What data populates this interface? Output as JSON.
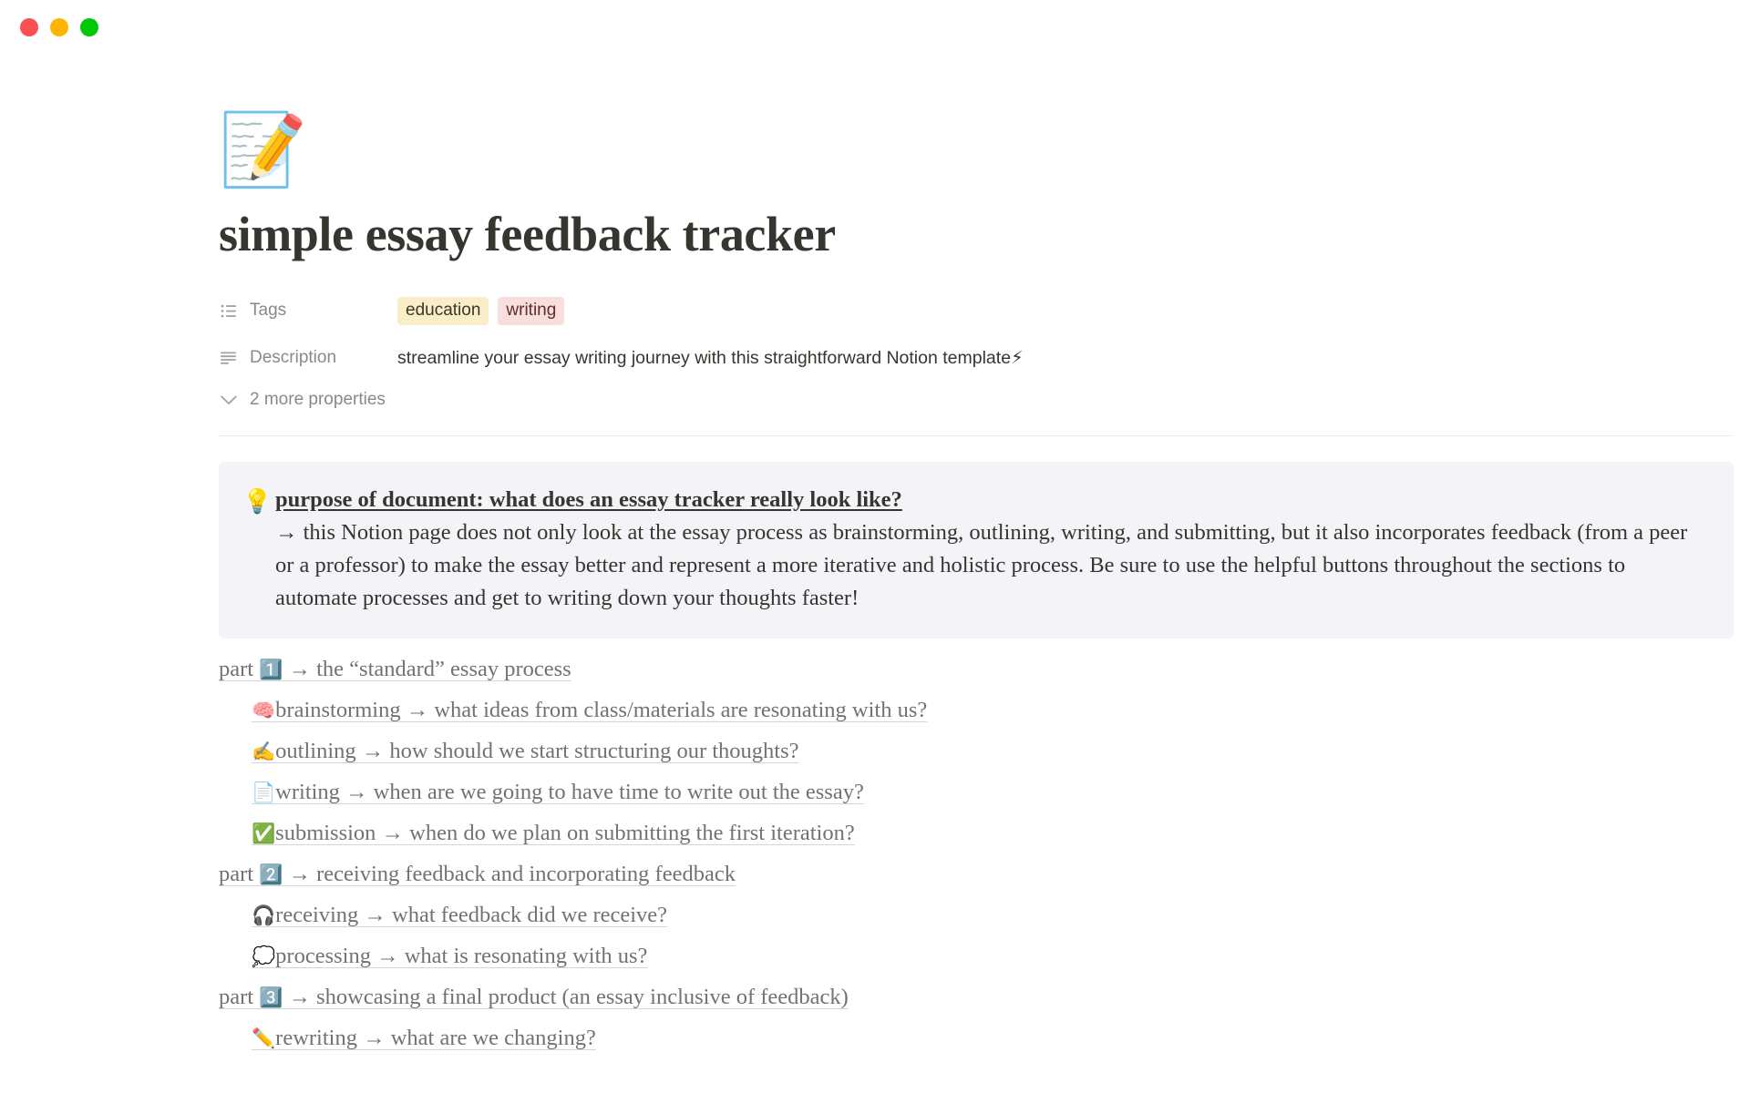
{
  "window": {
    "controls": [
      {
        "name": "close",
        "color": "#fc4f53"
      },
      {
        "name": "minimize",
        "color": "#ffb402"
      },
      {
        "name": "maximize",
        "color": "#00c707"
      }
    ]
  },
  "page": {
    "icon": "📝",
    "title": "simple essay feedback tracker"
  },
  "properties": {
    "rows": [
      {
        "icon": "multi-select-icon",
        "label": "Tags",
        "type": "tags",
        "tags": [
          {
            "label": "education",
            "bg": "#faeec8",
            "fg": "#3c3528"
          },
          {
            "label": "writing",
            "bg": "#f8dfde",
            "fg": "#5e2c2c"
          }
        ]
      },
      {
        "icon": "text-icon",
        "label": "Description",
        "type": "text",
        "value": "streamline your essay writing journey with this straightforward Notion template",
        "trailing_emoji": "⚡"
      }
    ],
    "more_label": "2 more properties"
  },
  "callout": {
    "icon": "💡",
    "background": "#f4f3f7",
    "heading": "purpose of document: what does an essay tracker really look like?",
    "body": "→ this Notion page does not only look at the essay process as brainstorming, outlining, writing, and submitting, but it also incorporates feedback (from a peer or a professor) to make the essay better and represent a more iterative and holistic process. Be sure to use the helpful buttons throughout the sections to automate processes and get to writing down your thoughts faster!"
  },
  "links": [
    {
      "indent": false,
      "emoji": "",
      "prefix": "part ",
      "keycap": "1️⃣",
      "text": " → the “standard” essay process"
    },
    {
      "indent": true,
      "emoji": "🧠",
      "prefix": "",
      "keycap": "",
      "text": "brainstorming → what ideas from class/materials are resonating with us?"
    },
    {
      "indent": true,
      "emoji": "✍️",
      "prefix": "",
      "keycap": "",
      "text": "outlining → how should we start structuring our thoughts?"
    },
    {
      "indent": true,
      "emoji": "📄",
      "prefix": "",
      "keycap": "",
      "text": "writing → when are we going to have time to write out the essay?"
    },
    {
      "indent": true,
      "emoji": "✅",
      "prefix": "",
      "keycap": "",
      "text": "submission → when do we plan on submitting the first iteration?"
    },
    {
      "indent": false,
      "emoji": "",
      "prefix": "part ",
      "keycap": "2️⃣",
      "text": " → receiving feedback and incorporating feedback"
    },
    {
      "indent": true,
      "emoji": "🎧",
      "prefix": "",
      "keycap": "",
      "text": "receiving → what feedback did we receive?"
    },
    {
      "indent": true,
      "emoji": "💭",
      "prefix": "",
      "keycap": "",
      "text": "processing → what is resonating with us?"
    },
    {
      "indent": false,
      "emoji": "",
      "prefix": "part ",
      "keycap": "3️⃣",
      "text": " → showcasing a final product (an essay inclusive of feedback)"
    },
    {
      "indent": true,
      "emoji": "✏️",
      "prefix": "",
      "keycap": "",
      "text": "rewriting → what are we changing?"
    }
  ]
}
